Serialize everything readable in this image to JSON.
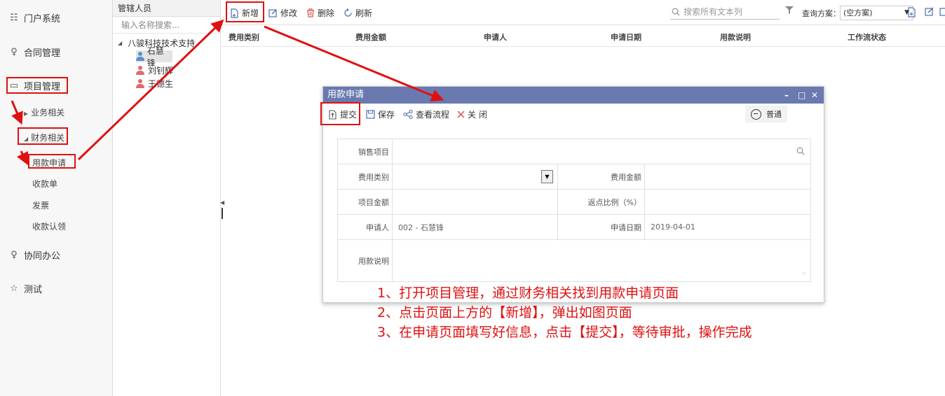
{
  "nav": {
    "portal": "门户系统",
    "contract": "合同管理",
    "project": "项目管理",
    "business": "业务相关",
    "finance": "财务相关",
    "payment_request": "用款申请",
    "receipt": "收款单",
    "invoice": "发票",
    "receipt_confirm": "收款认领",
    "collab": "协同办公",
    "test": "测试"
  },
  "tree": {
    "header": "管辖人员",
    "search_placeholder": "输入名称搜索...",
    "company": "八骏科技技术支持",
    "people": [
      "石慧锋",
      "刘钊辉",
      "王德生"
    ]
  },
  "toolbar": {
    "add": "新增",
    "edit": "修改",
    "delete": "删除",
    "refresh": "刷新",
    "search_placeholder": "搜索所有文本列",
    "query_label": "查询方案：",
    "query_value": "(空方案)"
  },
  "grid": {
    "columns": [
      "费用类别",
      "费用金额",
      "申请人",
      "申请日期",
      "用款说明",
      "工作流状态"
    ]
  },
  "dialog": {
    "title": "用款申请",
    "submit": "提交",
    "save": "保存",
    "view_flow": "查看流程",
    "close": "关 闭",
    "mode": "普通",
    "fields": {
      "sales_project": "销售项目",
      "expense_type": "费用类别",
      "expense_amount": "费用金额",
      "project_amount": "项目金额",
      "rebate_ratio": "返点比例（%）",
      "applicant": "申请人",
      "applicant_value": "002 - 石慧锋",
      "apply_date": "申请日期",
      "apply_date_value": "2019-04-01",
      "description": "用款说明"
    }
  },
  "instructions": [
    "1、打开项目管理，通过财务相关找到用款申请页面",
    "2、点击页面上方的【新增】，弹出如图页面",
    "3、在申请页面填写好信息，点击【提交】，等待审批，操作完成"
  ],
  "colors": {
    "annotation_red": "#e01010",
    "dialog_title": "#6a7ab0",
    "person_selected": "#5b8fd0",
    "person_other": "#e06a6a",
    "delete_icon": "#d9534f"
  }
}
